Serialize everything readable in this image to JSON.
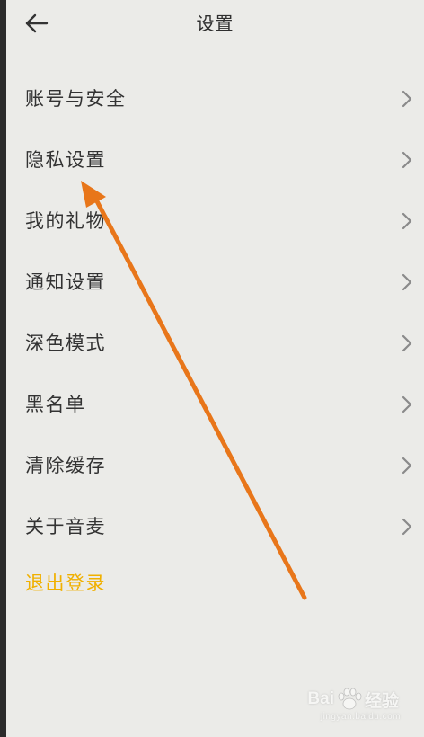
{
  "header": {
    "title": "设置",
    "back_icon": "back-arrow-icon"
  },
  "menu": {
    "items": [
      {
        "label": "账号与安全",
        "icon": "chevron-right-icon"
      },
      {
        "label": "隐私设置",
        "icon": "chevron-right-icon"
      },
      {
        "label": "我的礼物",
        "icon": "chevron-right-icon"
      },
      {
        "label": "通知设置",
        "icon": "chevron-right-icon"
      },
      {
        "label": "深色模式",
        "icon": "chevron-right-icon"
      },
      {
        "label": "黑名单",
        "icon": "chevron-right-icon"
      },
      {
        "label": "清除缓存",
        "icon": "chevron-right-icon"
      },
      {
        "label": "关于音麦",
        "icon": "chevron-right-icon"
      }
    ]
  },
  "logout": {
    "label": "退出登录"
  },
  "annotation": {
    "icon": "orange-pointer-arrow",
    "color": "#e8761a",
    "points_to": "隐私设置"
  },
  "watermark": {
    "brand_left": "Bai",
    "brand_right": "经验",
    "sub": "jingyan.baidu.com",
    "icon": "paw-icon"
  },
  "colors": {
    "background": "#ebebe8",
    "text": "#333333",
    "logout": "#f0b000",
    "chevron": "#8a8a8a",
    "arrow": "#e8761a"
  }
}
